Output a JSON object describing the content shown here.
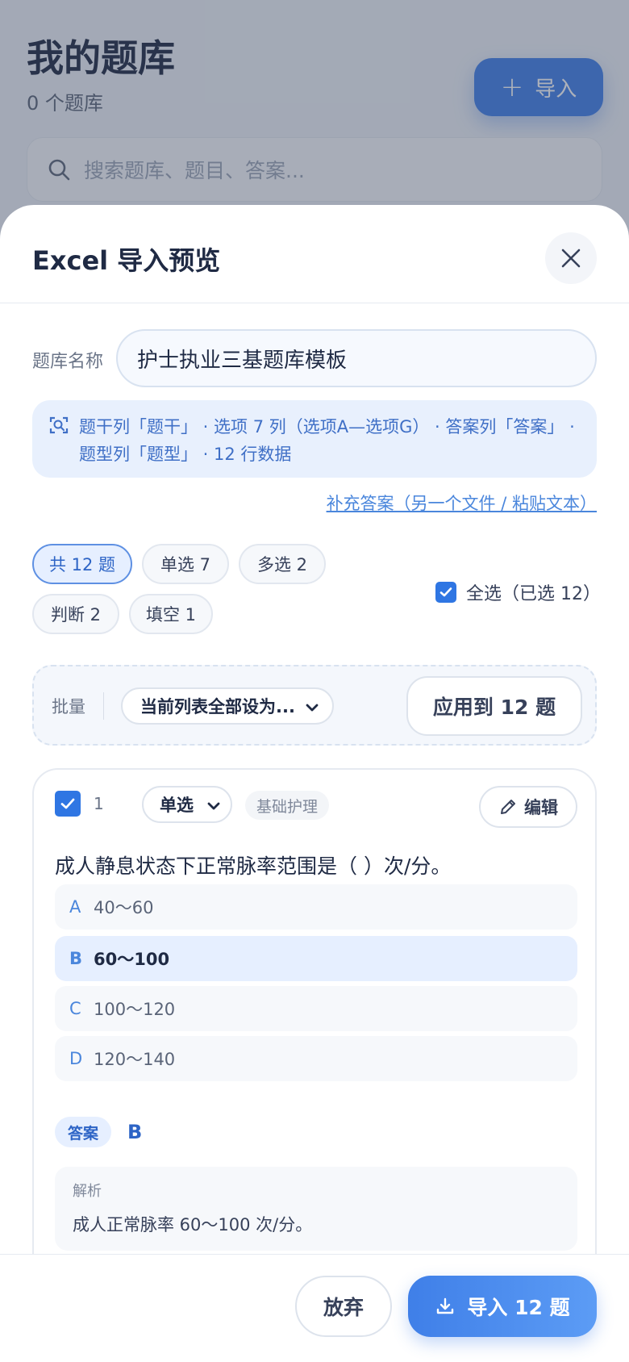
{
  "background": {
    "title": "我的题库",
    "count": "0 个题库",
    "import_label": "导入",
    "search_placeholder": "搜索题库、题目、答案..."
  },
  "sheet": {
    "title": "Excel 导入预览",
    "bank_name_label": "题库名称",
    "bank_name_value": "护士执业三基题库模板",
    "info_text": "题干列「题干」 · 选项 7 列（选项A—选项G） · 答案列「答案」 · 题型列「题型」 · 12 行数据",
    "supplement_link": "补充答案（另一个文件 / 粘贴文本）",
    "filters": [
      {
        "label": "共 12 题",
        "active": true
      },
      {
        "label": "单选 7",
        "active": false
      },
      {
        "label": "多选 2",
        "active": false
      },
      {
        "label": "判断 2",
        "active": false
      },
      {
        "label": "填空 1",
        "active": false
      }
    ],
    "select_all": "全选（已选 12）",
    "batch": {
      "label": "批量",
      "dropdown": "当前列表全部设为...",
      "apply": "应用到 12 题"
    },
    "question": {
      "number": "1",
      "type": "单选",
      "category": "基础护理",
      "edit": "编辑",
      "stem": "成人静息状态下正常脉率范围是（ ）次/分。",
      "options": [
        {
          "letter": "A",
          "text": "40～60",
          "correct": false
        },
        {
          "letter": "B",
          "text": "60～100",
          "correct": true
        },
        {
          "letter": "C",
          "text": "100～120",
          "correct": false
        },
        {
          "letter": "D",
          "text": "120～140",
          "correct": false
        }
      ],
      "answer_tag": "答案",
      "answer": "B",
      "analysis_title": "解析",
      "analysis": "成人正常脉率 60～100 次/分。"
    },
    "footer": {
      "discard": "放弃",
      "import": "导入 12 题"
    }
  },
  "colors": {
    "accent": "#3f7fe8",
    "accent_light": "#e6efff",
    "overlay": "rgba(60,70,90,0.42)"
  },
  "icons": [
    "plus-icon",
    "search-icon",
    "close-icon",
    "scan-icon",
    "check-icon",
    "chevron-down-icon",
    "pencil-icon",
    "download-icon"
  ]
}
